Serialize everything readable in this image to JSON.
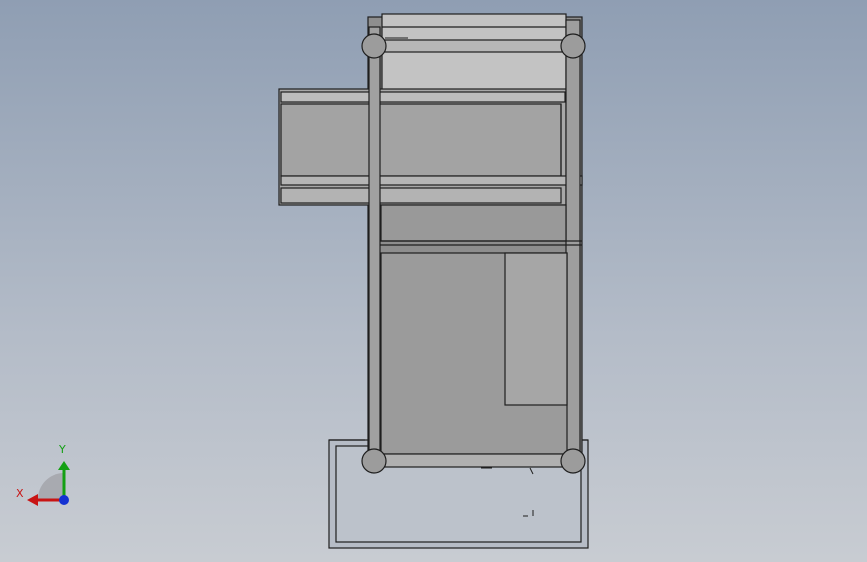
{
  "viewport": {
    "background_top": "#8f9eb3",
    "background_bottom": "#c8ccd2"
  },
  "model": {
    "edge_color": "#1e1e1e",
    "face_light": "#c3c3c3",
    "face_mid": "#a8a8a8",
    "face_dark": "#9a9a9a",
    "joint_color": "#9c9c9c"
  },
  "triad": {
    "x_label": "X",
    "y_label": "Y",
    "x_color": "#c81414",
    "y_color": "#14a014",
    "z_color": "#1432d2"
  }
}
